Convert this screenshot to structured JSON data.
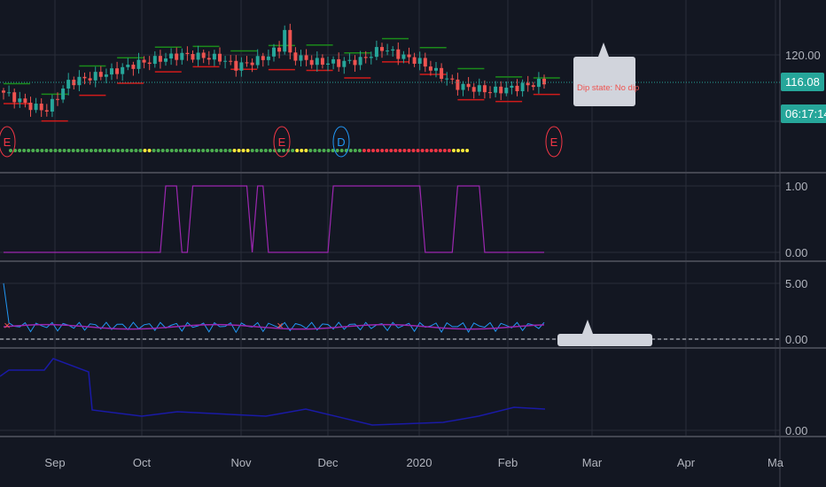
{
  "chart_data": {
    "type": "candlestick",
    "main": {
      "price_labels": [
        "120.00"
      ],
      "last_price": "116.08",
      "countdown": "06:17:14",
      "close_anchors": [
        [
          0,
          114.5
        ],
        [
          5,
          112.5
        ],
        [
          8,
          112
        ],
        [
          12,
          116
        ],
        [
          20,
          117.5
        ],
        [
          25,
          118.8
        ],
        [
          33,
          120
        ],
        [
          40,
          119.5
        ],
        [
          43,
          118.3
        ],
        [
          48,
          119.5
        ],
        [
          51,
          121
        ],
        [
          52,
          123.5
        ],
        [
          53,
          120
        ],
        [
          57,
          119
        ],
        [
          62,
          118.8
        ],
        [
          66,
          119.2
        ],
        [
          70,
          121
        ],
        [
          73,
          120
        ],
        [
          77,
          119
        ],
        [
          80,
          117.5
        ],
        [
          84,
          115.5
        ],
        [
          88,
          115
        ],
        [
          90,
          114.7
        ],
        [
          95,
          115.3
        ],
        [
          100,
          116.08
        ]
      ],
      "markers": [
        {
          "label": "E",
          "color": "#f23645"
        },
        {
          "label": "E",
          "color": "#f23645"
        },
        {
          "label": "D",
          "color": "#2196f3"
        },
        {
          "label": "E",
          "color": "#f23645"
        }
      ],
      "dip_label": "Dip state: No dip",
      "dot_segments": [
        {
          "color": "#4caf50",
          "count": 30
        },
        {
          "color": "#ffeb3b",
          "count": 2
        },
        {
          "color": "#4caf50",
          "count": 18
        },
        {
          "color": "#ffeb3b",
          "count": 4
        },
        {
          "color": "#4caf50",
          "count": 10
        },
        {
          "color": "#ffeb3b",
          "count": 3
        },
        {
          "color": "#4caf50",
          "count": 12
        },
        {
          "color": "#f23645",
          "count": 20
        },
        {
          "color": "#ffeb3b",
          "count": 4
        }
      ]
    },
    "pane2": {
      "labels": [
        "1.00",
        "0.00"
      ],
      "high_ranges": [
        [
          30,
          32
        ],
        [
          35,
          45
        ],
        [
          47,
          48
        ],
        [
          61,
          62
        ],
        [
          63,
          77
        ],
        [
          84,
          88
        ]
      ]
    },
    "pane3": {
      "labels": [
        "5.00",
        "0.00"
      ]
    },
    "pane4": {
      "labels": [
        "0.00"
      ]
    },
    "x_labels": [
      "Sep",
      "Oct",
      "Nov",
      "Dec",
      "2020",
      "Feb",
      "Mar",
      "Apr",
      "Ma"
    ],
    "colors": {
      "up": "#26a69a",
      "down": "#ef5350",
      "bg": "#131722"
    }
  }
}
